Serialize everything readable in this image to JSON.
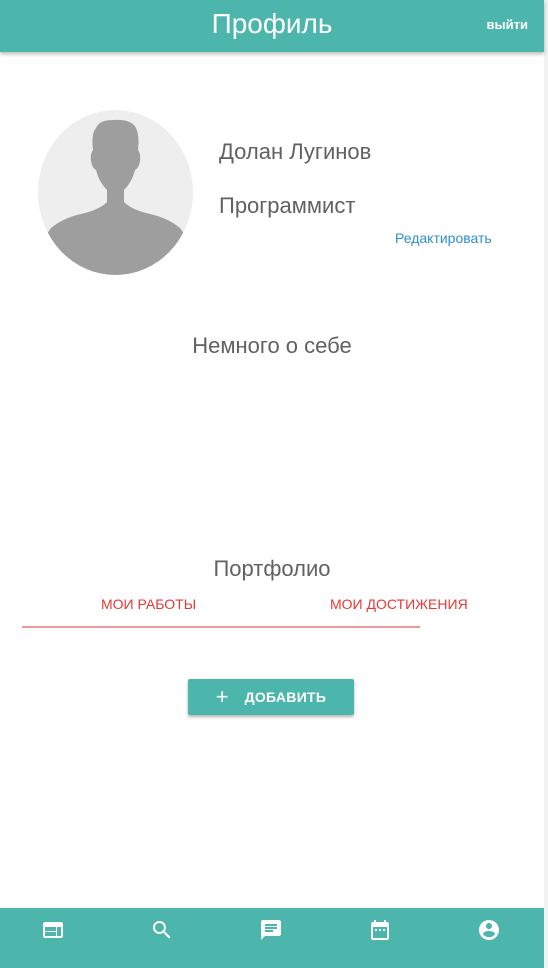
{
  "app_bar": {
    "title": "Профиль",
    "logout_label": "выйти"
  },
  "profile": {
    "name": "Долан Лугинов",
    "role": "Программист",
    "edit_label": "Редактировать",
    "avatar_icon": "person-silhouette-icon"
  },
  "about": {
    "title": "Немного о себе"
  },
  "portfolio": {
    "title": "Портфолио",
    "tabs": [
      {
        "label": "МОИ РАБОТЫ"
      },
      {
        "label": "МОИ ДОСТИЖЕНИЯ"
      }
    ],
    "add_button": {
      "icon": "+",
      "label": "ДОБАВИТЬ"
    }
  },
  "bottom_nav": {
    "items": [
      {
        "icon": "feed-icon"
      },
      {
        "icon": "search-icon"
      },
      {
        "icon": "chat-icon"
      },
      {
        "icon": "calendar-icon"
      },
      {
        "icon": "account-icon"
      }
    ]
  },
  "colors": {
    "primary": "#4db6ac",
    "accent_red": "#e53935",
    "link_blue": "#2f8fd2",
    "text_gray": "#616161"
  }
}
